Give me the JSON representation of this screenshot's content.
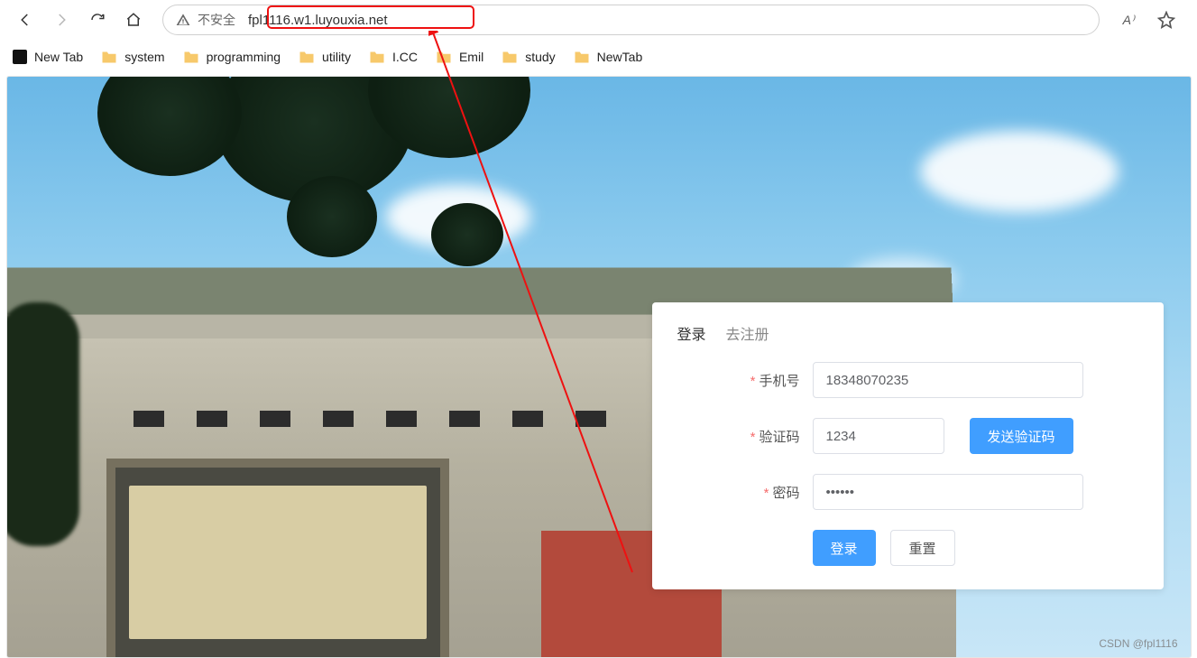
{
  "browser": {
    "insecure_label": "不安全",
    "url": "fpl1116.w1.luyouxia.net",
    "read_aloud_label": "A⁾",
    "bookmarks": [
      {
        "type": "square",
        "label": "New Tab"
      },
      {
        "type": "folder",
        "label": "system"
      },
      {
        "type": "folder",
        "label": "programming"
      },
      {
        "type": "folder",
        "label": "utility"
      },
      {
        "type": "folder",
        "label": "I.CC"
      },
      {
        "type": "folder",
        "label": "Emil"
      },
      {
        "type": "folder",
        "label": "study"
      },
      {
        "type": "folder",
        "label": "NewTab"
      }
    ]
  },
  "login": {
    "tab_login": "登录",
    "tab_register": "去注册",
    "phone_label": "手机号",
    "phone_value": "18348070235",
    "code_label": "验证码",
    "code_value": "1234",
    "send_code_label": "发送验证码",
    "password_label": "密码",
    "password_value": "••••••",
    "submit_label": "登录",
    "reset_label": "重置"
  },
  "watermark": "CSDN @fpl1116",
  "colors": {
    "primary": "#409eff",
    "required": "#f56c6c",
    "annotation": "#e11"
  }
}
